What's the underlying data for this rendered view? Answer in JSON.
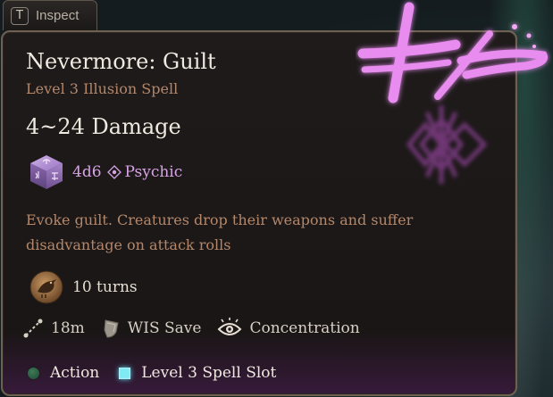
{
  "inspect_tab": {
    "key": "T",
    "label": "Inspect"
  },
  "spell": {
    "name": "Nevermore: Guilt",
    "subtitle": "Level 3 Illusion Spell",
    "damage": "4~24 Damage",
    "dice": "4d6",
    "damage_type": "Psychic",
    "description": "Evoke guilt. Creatures drop their weapons and suffer disadvantage on attack rolls",
    "duration": "10 turns",
    "range": "18m",
    "save": "WIS Save",
    "concentration": "Concentration"
  },
  "costs": {
    "action": "Action",
    "slot": "Level 3 Spell Slot"
  },
  "icons": {
    "key": "key-cap-icon",
    "dice": "dice-icon",
    "psychic": "psychic-icon",
    "duration": "raven-icon",
    "range": "range-icon",
    "save": "shield-icon",
    "concentration": "eye-icon",
    "action": "action-dot-icon",
    "slot": "spell-slot-icon"
  },
  "colors": {
    "title": "#efe9df",
    "subtitle": "#b4876a",
    "psychic": "#d7a4e6",
    "glyph": "#e36ee8",
    "slot": "#7fe9f4",
    "action": "#3f7a57",
    "border": "#6e6152"
  }
}
